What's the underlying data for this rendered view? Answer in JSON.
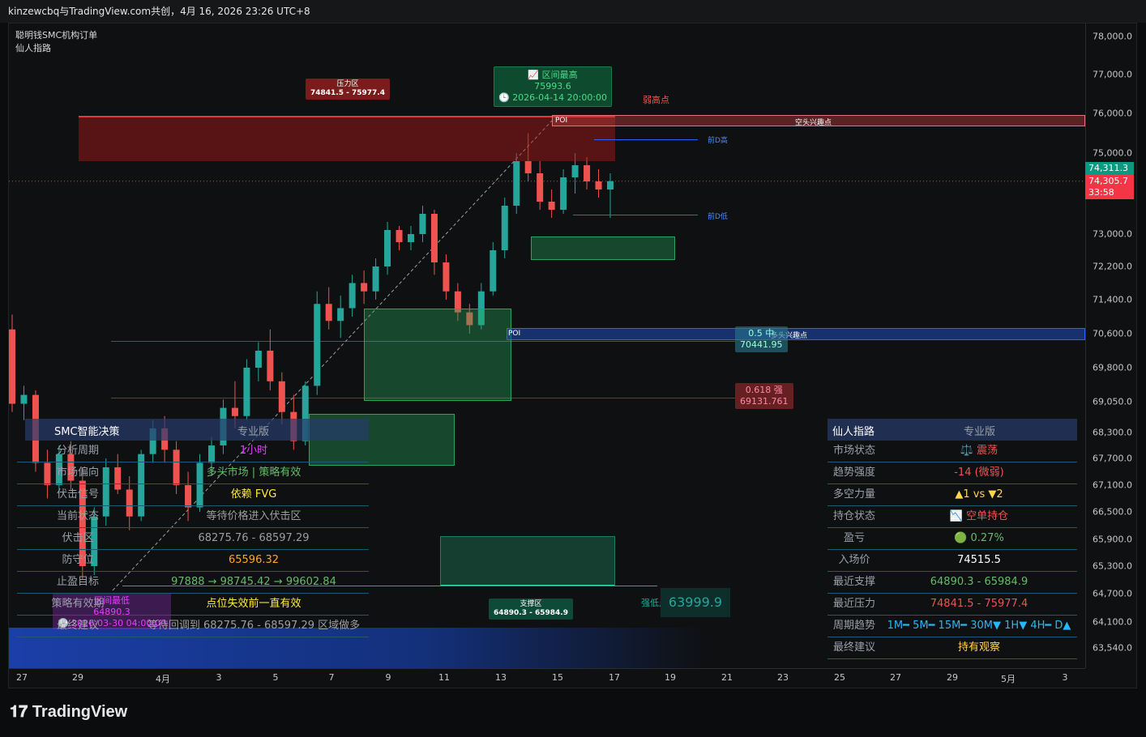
{
  "header": {
    "text": "kinzewcbq与TradingView.com共创，4月 16, 2026 23:26 UTC+8"
  },
  "indicators": [
    "聪明钱SMC机构订单",
    "仙人指路"
  ],
  "colors": {
    "bull": "#26a69a",
    "bear": "#ef5350",
    "bg": "#0f1012",
    "panel_line": "#1e5a73"
  },
  "chart_data": {
    "type": "candlestick",
    "y_ticks": [
      "78,000.0",
      "77,000.0",
      "76,000.0",
      "75,000.0",
      "73,000.0",
      "72,200.0",
      "71,400.0",
      "70,600.0",
      "69,800.0",
      "69,050.0",
      "68,300.0",
      "67,700.0",
      "67,100.0",
      "66,500.0",
      "65,900.0",
      "65,300.0",
      "64,700.0",
      "64,100.0",
      "63,540.0"
    ],
    "y_values": [
      78000,
      77000,
      76000,
      75000,
      73000,
      72200,
      71400,
      70600,
      69800,
      69050,
      68300,
      67700,
      67100,
      66500,
      65900,
      65300,
      64700,
      64100,
      63540
    ],
    "x_ticks": [
      "27",
      "29",
      "4月",
      "3",
      "5",
      "7",
      "9",
      "11",
      "13",
      "15",
      "17",
      "19",
      "21",
      "23",
      "25",
      "27",
      "29",
      "5月",
      "3"
    ],
    "current_price_high": "74,311.3",
    "current_price": "74,305.7",
    "countdown": "33:58",
    "ohlc_hourly_sample": [
      [
        70700,
        71050,
        68800,
        69000
      ],
      [
        69000,
        69400,
        68600,
        69200
      ],
      [
        69200,
        69300,
        67400,
        67600
      ],
      [
        67600,
        67900,
        66800,
        67100
      ],
      [
        67100,
        68000,
        66900,
        67800
      ],
      [
        67800,
        68100,
        67000,
        67200
      ],
      [
        67200,
        67500,
        65000,
        65300
      ],
      [
        65300,
        66600,
        65100,
        66400
      ],
      [
        66400,
        67700,
        66200,
        67500
      ],
      [
        67500,
        67800,
        66900,
        67000
      ],
      [
        67000,
        67300,
        66100,
        66400
      ],
      [
        66400,
        67900,
        66300,
        67800
      ],
      [
        67800,
        68600,
        67600,
        68400
      ],
      [
        68400,
        68700,
        67600,
        67900
      ],
      [
        67900,
        68100,
        66900,
        67100
      ],
      [
        67100,
        67400,
        66300,
        66600
      ],
      [
        66600,
        67800,
        66500,
        67600
      ],
      [
        67600,
        68200,
        67300,
        68000
      ],
      [
        68000,
        69100,
        67800,
        68900
      ],
      [
        68900,
        69500,
        68400,
        68700
      ],
      [
        68700,
        70000,
        68600,
        69800
      ],
      [
        69800,
        70400,
        69500,
        70200
      ],
      [
        70200,
        70700,
        69300,
        69500
      ],
      [
        69500,
        69700,
        68500,
        68800
      ],
      [
        68800,
        69200,
        67900,
        68100
      ],
      [
        68100,
        69500,
        68000,
        69400
      ],
      [
        69400,
        71600,
        69200,
        71300
      ],
      [
        71300,
        71700,
        70700,
        70900
      ],
      [
        70900,
        71500,
        70500,
        71200
      ],
      [
        71200,
        72000,
        71000,
        71800
      ],
      [
        71800,
        72100,
        71300,
        71600
      ],
      [
        71600,
        72400,
        71400,
        72200
      ],
      [
        72200,
        73300,
        72000,
        73100
      ],
      [
        73100,
        73200,
        72600,
        72800
      ],
      [
        72800,
        73200,
        72600,
        73000
      ],
      [
        73000,
        73700,
        72800,
        73500
      ],
      [
        73500,
        73600,
        72000,
        72300
      ],
      [
        72300,
        72500,
        71400,
        71600
      ],
      [
        71600,
        71800,
        70900,
        71100
      ],
      [
        71100,
        71300,
        70600,
        70800
      ],
      [
        70800,
        71800,
        70700,
        71600
      ],
      [
        71600,
        72800,
        71500,
        72600
      ],
      [
        72600,
        73900,
        72400,
        73700
      ],
      [
        73700,
        75000,
        73500,
        74800
      ],
      [
        74800,
        75500,
        74300,
        74500
      ],
      [
        74500,
        74800,
        73600,
        73800
      ],
      [
        73800,
        74100,
        73400,
        73600
      ],
      [
        73600,
        74600,
        73500,
        74400
      ],
      [
        74400,
        75000,
        74000,
        74700
      ],
      [
        74700,
        74900,
        74100,
        74300
      ],
      [
        74300,
        74600,
        73900,
        74100
      ],
      [
        74100,
        74500,
        73400,
        74306
      ]
    ]
  },
  "smc_zones": {
    "pressure_zone_title": "压力区",
    "pressure_zone_range": "74841.5 - 75977.4",
    "support_zone_title": "支撑区",
    "support_zone_range": "64890.3 - 65984.9",
    "range_high_title": "区间最高",
    "range_high_value": "75993.6",
    "range_high_time": "2026-04-14 20:00:00",
    "weak_high": "弱高点",
    "short_interest": "空头兴趣点",
    "long_interest": "多头兴趣点",
    "poi": "POI",
    "prev_day_high": "前D高",
    "prev_day_low": "前D低",
    "fib_05_label": "0.5 中",
    "fib_05_value": "70441.95",
    "fib_0618_label": "0.618 强",
    "fib_0618_value": "69131.761",
    "strong_low": "强低点",
    "strong_low_value": "63999.9",
    "range_low_title": "区间最低",
    "range_low_value": "64890.3",
    "range_low_time": "2026-03-30 04:00:00"
  },
  "smc_panel": {
    "title": "SMC智能决策",
    "edition": "专业版",
    "rows": [
      {
        "label": "分析周期",
        "value": "1小时",
        "color": "#e040fb"
      },
      {
        "label": "市场偏向",
        "value": "多头市场 | 策略有效",
        "color": "#66bb6a"
      },
      {
        "label": "伏击信号",
        "value": "依赖 FVG",
        "color": "#ffeb3b"
      },
      {
        "label": "当前状态",
        "value": "等待价格进入伏击区",
        "color": "#9e9e9e"
      },
      {
        "label": "伏击区",
        "value": "68275.76 - 68597.29",
        "color": "#9e9e9e"
      },
      {
        "label": "防守位",
        "value": "65596.32",
        "color": "#ffa726"
      },
      {
        "label": "止盈目标",
        "value": "97888 → 98745.42 → 99602.84",
        "color": "#66bb6a"
      },
      {
        "label": "策略有效期",
        "value": "点位失效前一直有效",
        "color": "#ffeb3b"
      },
      {
        "label": "最终建议",
        "value": "等待回调到 68275.76 - 68597.29 区域做多",
        "color": "#9e9e9e"
      }
    ]
  },
  "xr_panel": {
    "title": "仙人指路",
    "edition": "专业版",
    "rows": [
      {
        "label": "市场状态",
        "value": "⚖️ 震荡",
        "color": "#ef5350"
      },
      {
        "label": "趋势强度",
        "value": "-14 (微弱)",
        "color": "#ef5350"
      },
      {
        "label": "多空力量",
        "value": "▲1  vs  ▼2",
        "color": "#ffd54f"
      },
      {
        "label": "持仓状态",
        "value": "📉 空单持仓",
        "color": "#ef5350"
      },
      {
        "label": "盈亏",
        "value": "🟢 0.27%",
        "color": "#66bb6a"
      },
      {
        "label": "入场价",
        "value": "74515.5",
        "color": "#ffffff"
      },
      {
        "label": "最近支撑",
        "value": "64890.3 - 65984.9",
        "color": "#66bb6a"
      },
      {
        "label": "最近压力",
        "value": "74841.5 - 75977.4",
        "color": "#ef5350"
      },
      {
        "label": "周期趋势",
        "value": "1M━ 5M━ 15M━ 30M▼ 1H▼ 4H━ D▲",
        "color": "#29b6f6"
      },
      {
        "label": "最终建议",
        "value": "持有观察",
        "color": "#ffd54f"
      }
    ]
  },
  "footer": {
    "brand": "TradingView"
  }
}
